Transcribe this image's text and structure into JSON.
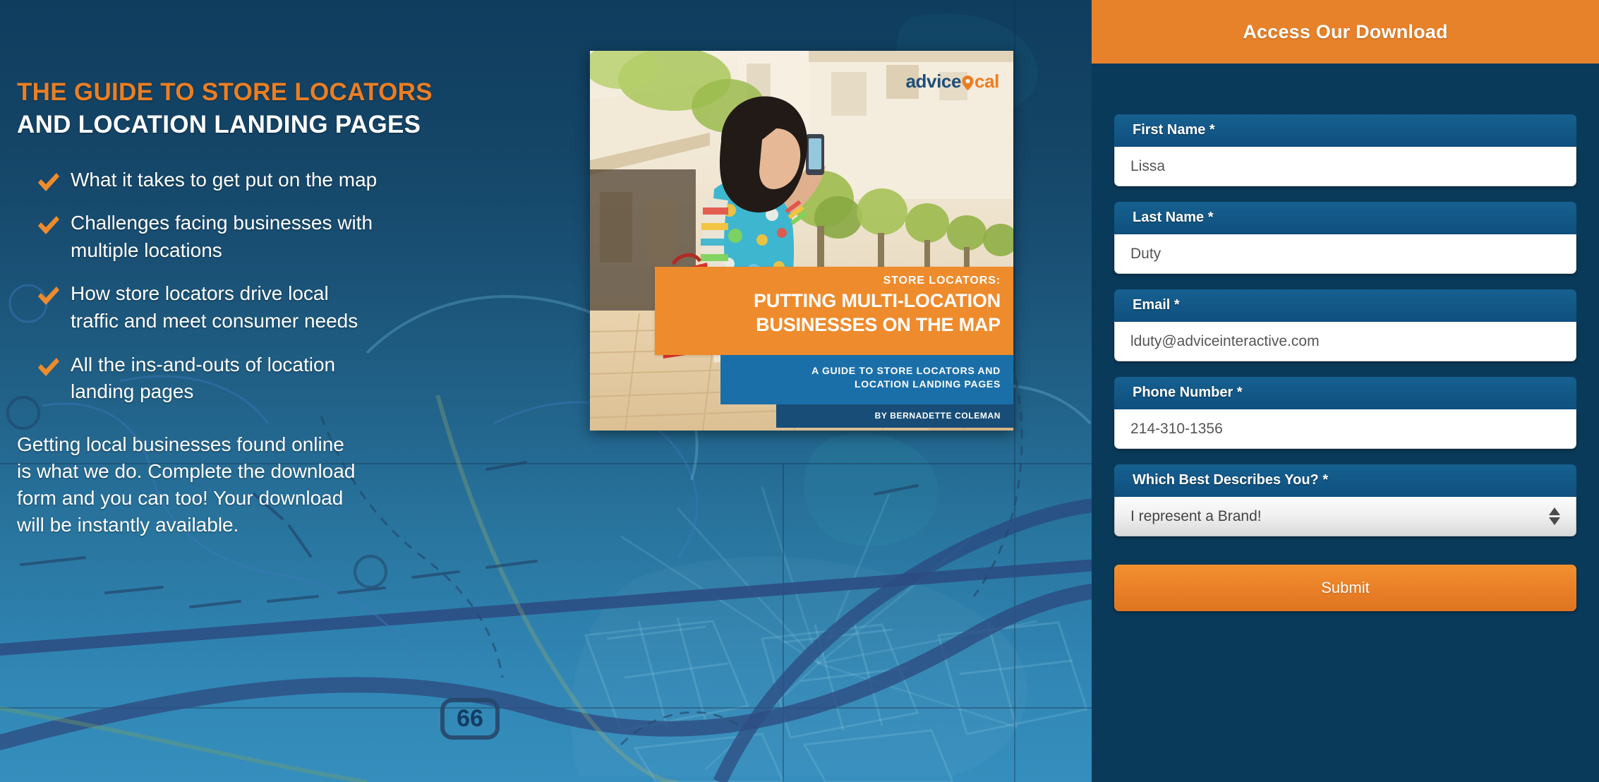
{
  "hero": {
    "headline_line1": "THE GUIDE TO STORE LOCATORS",
    "headline_line2": "AND LOCATION LANDING PAGES",
    "bullets": [
      "What it takes to get put on the map",
      "Challenges facing businesses with multiple locations",
      "How store locators drive local traffic and meet consumer needs",
      "All the ins-and-outs of location landing pages"
    ],
    "paragraph": "Getting local businesses found online is what we do. Complete the download form and you can too! Your download will be instantly available.",
    "route_marker": "66"
  },
  "cover": {
    "logo_prefix": "advice",
    "logo_suffix": "cal",
    "eyebrow": "STORE LOCATORS:",
    "title_line1": "PUTTING MULTI-LOCATION",
    "title_line2": "BUSINESSES ON THE MAP",
    "subtitle_line1": "A GUIDE TO STORE LOCATORS AND",
    "subtitle_line2": "LOCATION LANDING PAGES",
    "author": "BY BERNADETTE COLEMAN"
  },
  "form": {
    "header_title": "Access Our Download",
    "fields": [
      {
        "label": "First Name *",
        "value": "Lissa",
        "type": "text"
      },
      {
        "label": "Last Name *",
        "value": "Duty",
        "type": "text"
      },
      {
        "label": "Email *",
        "value": "lduty@adviceinteractive.com",
        "type": "email"
      },
      {
        "label": "Phone Number *",
        "value": "214-310-1356",
        "type": "tel"
      },
      {
        "label": "Which Best Describes You? *",
        "value": "I represent a Brand!",
        "type": "select"
      }
    ],
    "submit_label": "Submit"
  },
  "colors": {
    "accent_orange": "#e8822a",
    "panel_navy": "#0a3a5a",
    "label_blue": "#16608f",
    "hero_top": "#0b3a5c",
    "hero_bottom": "#2183b7",
    "cover_band_orange": "#ee8b2c",
    "cover_band_blue": "#1b6fa8"
  }
}
